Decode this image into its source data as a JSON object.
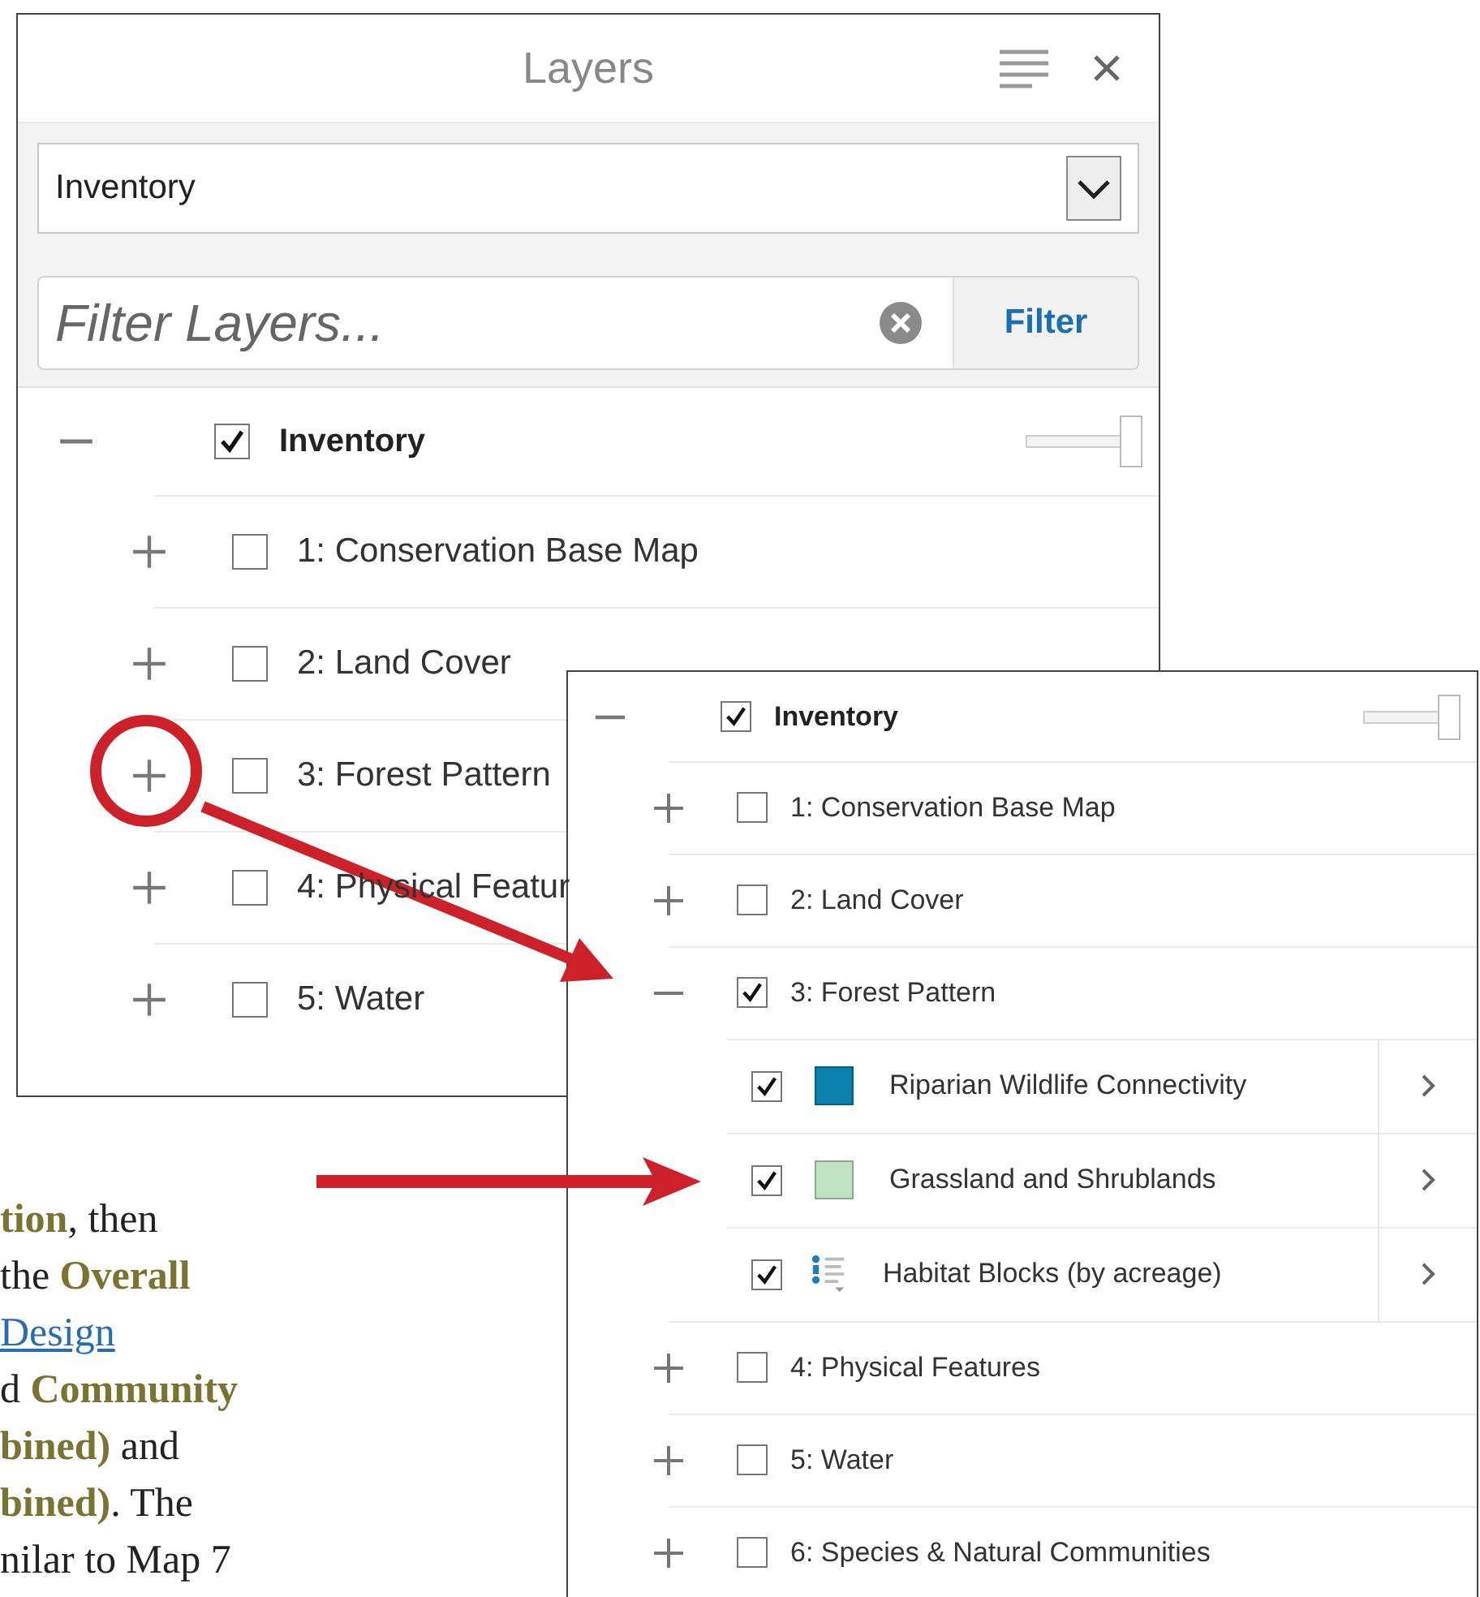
{
  "panels": [
    {
      "title": "Layers",
      "dropdown": {
        "value": "Inventory"
      },
      "filter": {
        "placeholder": "Filter Layers...",
        "button": "Filter"
      },
      "group": {
        "label": "Inventory",
        "checked": true,
        "expanded": true,
        "level": 1
      },
      "layers": [
        {
          "label": "1: Conservation Base Map",
          "checked": false,
          "expanded": false
        },
        {
          "label": "2: Land Cover",
          "checked": false,
          "expanded": false
        },
        {
          "label": "3: Forest Pattern",
          "checked": false,
          "expanded": false
        },
        {
          "label": "4: Physical Featur",
          "checked": false,
          "expanded": false
        },
        {
          "label": "5: Water",
          "checked": false,
          "expanded": false
        }
      ]
    },
    {
      "group": {
        "label": "Inventory",
        "checked": true,
        "expanded": true,
        "level": 1
      },
      "layers": [
        {
          "label": "1: Conservation Base Map",
          "checked": false,
          "expanded": false
        },
        {
          "label": "2: Land Cover",
          "checked": false,
          "expanded": false
        },
        {
          "label": "3: Forest Pattern",
          "checked": true,
          "expanded": true,
          "children": [
            {
              "label": "Riparian Wildlife Connectivity",
              "checked": true,
              "kind": "swatch",
              "color": "#0a80ad"
            },
            {
              "label": "Grassland and Shrublands",
              "checked": true,
              "kind": "swatch",
              "color": "#bfe2c0"
            },
            {
              "label": "Habitat Blocks (by acreage)",
              "checked": true,
              "kind": "legend"
            }
          ]
        },
        {
          "label": "4: Physical Features",
          "checked": false,
          "expanded": false
        },
        {
          "label": "5: Water",
          "checked": false,
          "expanded": false
        },
        {
          "label": "6: Species & Natural Communities",
          "checked": false,
          "expanded": false
        }
      ]
    }
  ],
  "annotation_text": [
    {
      "kind": "text",
      "text": "**tion**, then"
    },
    {
      "kind": "text",
      "text": "the **Overall**"
    },
    {
      "kind": "link",
      "text": "Design"
    },
    {
      "kind": "text",
      "text": "d **Community**"
    },
    {
      "kind": "text",
      "text": "**bined)** and"
    },
    {
      "kind": "text",
      "text": "**bined)**. The"
    },
    {
      "kind": "text",
      "text": "nilar to Map 7"
    }
  ]
}
